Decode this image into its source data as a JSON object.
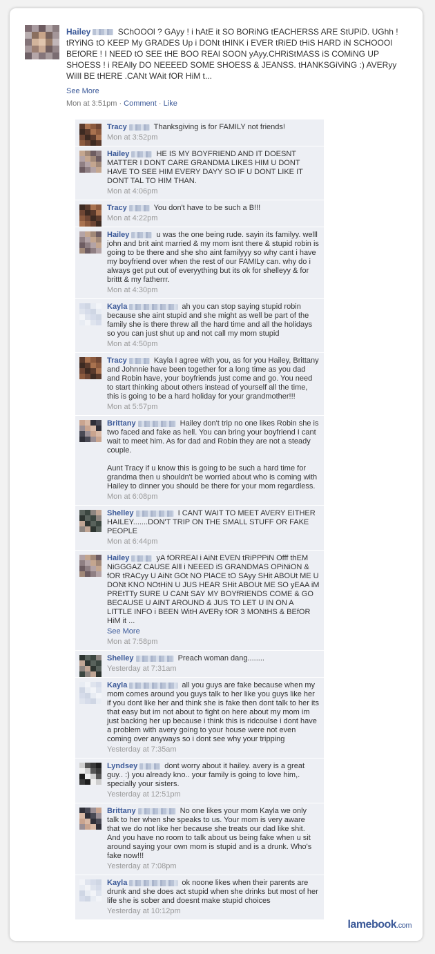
{
  "post": {
    "author": "Hailey",
    "text": "SChOOOl ? GAyy ! i hAtE it SO BORiNG tEACHERSS ARE StUPiD. UGhh ! tRYiNG tO KEEP My GRADES Up i DONt tHINK i EVER tRiED tHiS HARD iN SCHOOOl BEfORE ! I NEED tO SEE tHE BOO REAl SOON yAyy.CHRiStMASS iS COMiNG UP SHOESS ! i REAlly DO NEEEED SOME SHOESS & JEANSS. tHANKSGiViNG :) AVERyy Willl BE tHERE .CANt WAit fOR HiM t...",
    "see_more": "See More",
    "time": "Mon at 3:51pm",
    "comment_label": "Comment",
    "like_label": "Like",
    "separator": "·"
  },
  "comments": [
    {
      "author": "Tracy",
      "text": "Thanksgiving is for FAMILY not friends!",
      "time": "Mon at 3:52pm",
      "avatar": "tracy"
    },
    {
      "author": "Hailey",
      "text": "HE IS MY BOYFRIEND AND IT DOESNT MATTER I DONT CARE GRANDMA LIKES HIM U DONT HAVE TO SEE HIM EVERY DAYY SO IF U DONT LIKE IT DONT TAL TO HIM THAN.",
      "time": "Mon at 4:06pm",
      "avatar": "hailey"
    },
    {
      "author": "Tracy",
      "text": "You don't have to be such a B!!!",
      "time": "Mon at 4:22pm",
      "avatar": "tracy"
    },
    {
      "author": "Hailey",
      "text": "u was the one being rude. sayin its familyy. welll john and brit aint married & my mom isnt there & stupid robin is going to be there and she sho aint familyyy so why cant i have my boyfriend over when the rest of our FAMILy can. why do i always get put out of everyything but its ok for shelleyy & for brittt & my fatherrr.",
      "time": "Mon at 4:30pm",
      "avatar": "hailey"
    },
    {
      "author": "Kayla",
      "text": "ah you can stop saying stupid robin because she aint stupid and she might as well be part of the family she is there threw all the hard time and all the holidays so you can just shut up and not call my mom stupid",
      "time": "Mon at 4:50pm",
      "avatar": "kayla"
    },
    {
      "author": "Tracy",
      "text": "Kayla I agree with you, as for you Hailey, Brittany and Johnnie have been together for a long time as you dad and Robin have, your boyfriends just come and go. You need to start thinking about others instead of yourself all the time, this is going to be a hard holiday for your grandmother!!!",
      "time": "Mon at 5:57pm",
      "avatar": "tracy"
    },
    {
      "author": "Brittany",
      "text": "Hailey don't trip no one likes Robin she is two faced and fake as hell. You can bring your boyfriend I cant wait to meet him. As for dad and Robin they are not a steady couple.",
      "text2": "Aunt Tracy if u know this is going to be such a hard time for grandma then u shouldn't be worried about who is coming with Hailey to dinner you should be there for your mom regardless.",
      "time": "Mon at 6:08pm",
      "avatar": "brittany"
    },
    {
      "author": "Shelley",
      "text": "I CANT WAIT TO MEET AVERY EITHER HAILEY.......DON'T TRIP ON THE SMALL STUFF OR FAKE PEOPLE",
      "time": "Mon at 6:44pm",
      "avatar": "shelley"
    },
    {
      "author": "Hailey",
      "text": "yA fORREAl i AiNt EVEN tRiPPPiN Offf thEM NiGGGAZ CAUSE Alll i NEEED iS GRANDMAS OPiNiON & fOR tRACyy U AiNt GOt NO PlACE tO SAyy SHit ABOUt ME U DONt KNO NOtHiN U JUS HEAR SHit ABOUt ME SO yEAA iM PREtTTy SURE U CANt SAY MY BOYfRIENDS COME & GO BECAUSE U AINT AROUND & JUS TO LET U IN ON A LITTLE INFO i BEEN WitH AVERy fOR 3 MONtHS & BEfOR HiM it ...",
      "more": "See More",
      "time": "Mon at 7:58pm",
      "avatar": "hailey"
    },
    {
      "author": "Shelley",
      "text": "Preach woman dang........",
      "time": "Yesterday at 7:31am",
      "avatar": "shelley"
    },
    {
      "author": "Kayla",
      "text": "all you guys are fake because when my mom comes around you guys talk to her like you guys like her if you dont like her and think she is fake then dont talk to her its that easy but im not about to fight on here about my mom im just backing her up because i think this is ridcoulse i dont have a problem with avery going to your house were not even coming over anyways so i dont see why your tripping",
      "time": "Yesterday at 7:35am",
      "avatar": "kayla"
    },
    {
      "author": "Lyndsey",
      "text": "dont worry about it hailey. avery is a great guy.. :) you already kno.. your family is going to love him,. specially your sisters.",
      "time": "Yesterday at 12:51pm",
      "avatar": "lyndsey"
    },
    {
      "author": "Brittany",
      "text": "No one likes your mom Kayla we only talk to her when she speaks to us. Your mom is very aware that we do not like her because she treats our dad like shit. And you have no room to talk about us being fake when u sit around saying your own mom is stupid and is a drunk. Who's fake now!!!",
      "time": "Yesterday at 7:08pm",
      "avatar": "brittany"
    },
    {
      "author": "Kayla",
      "text": "ok noone likes when their parents are drunk and she does act stupid when she drinks but most of her life she is sober and doesnt make stupid choices",
      "time": "Yesterday at 10:12pm",
      "avatar": "kayla"
    }
  ],
  "logo": {
    "main": "lamebook",
    "suffix": ".com"
  },
  "colors": {
    "link": "#3b5998",
    "comment_bg": "#edeff4",
    "time": "#999999"
  }
}
